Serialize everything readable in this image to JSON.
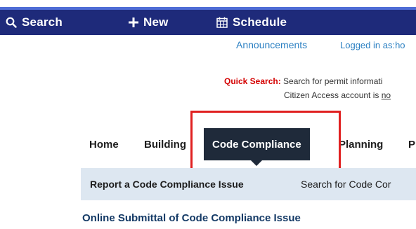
{
  "topbar": {
    "search_label": "Search",
    "new_label": "New",
    "schedule_label": "Schedule"
  },
  "header": {
    "announcements": "Announcements",
    "logged_in": "Logged in as:ho"
  },
  "quick_search": {
    "label": "Quick Search:",
    "text": "Search for permit informati",
    "line2_prefix": "Citizen Access account is ",
    "line2_link": "no"
  },
  "tabs": {
    "home": "Home",
    "building": "Building",
    "code_compliance": "Code Compliance",
    "planning": "Planning",
    "next_partial": "P"
  },
  "subnav": {
    "report": "Report a Code Compliance Issue",
    "search": "Search for Code Cor"
  },
  "main": {
    "heading": "Online Submittal of Code Compliance Issue"
  },
  "colors": {
    "topbar_bg": "#1e2a7a",
    "active_tab_bg": "#1f2a3a",
    "highlight_border": "#e02020",
    "link_blue": "#2a7fc2"
  }
}
